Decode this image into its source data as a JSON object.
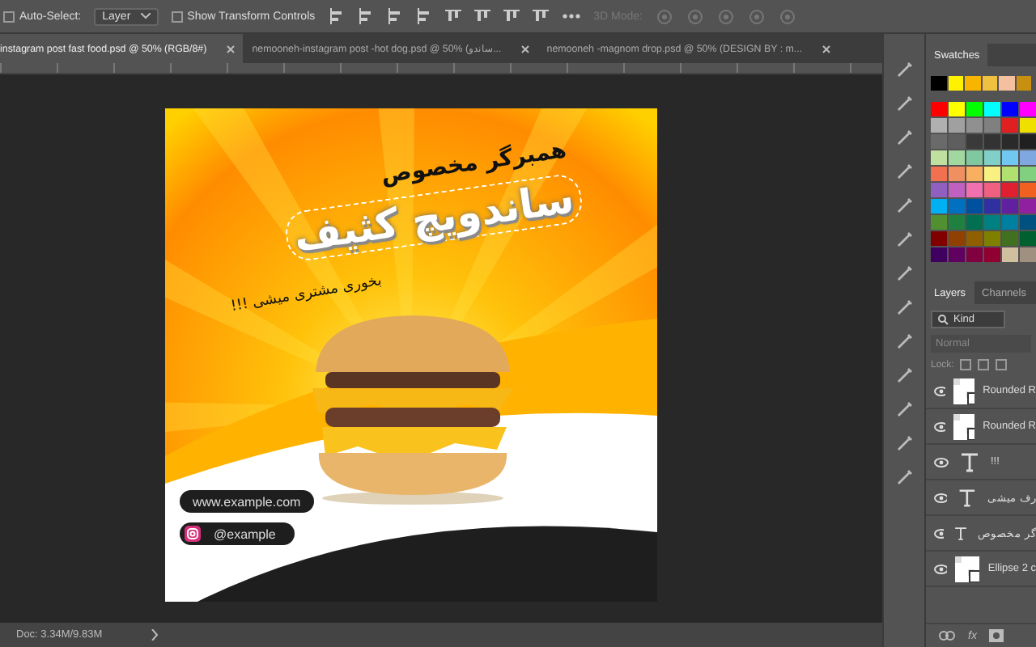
{
  "options_bar": {
    "auto_select": {
      "label": "Auto-Select:",
      "checked": false
    },
    "target": "Layer",
    "transform_controls": {
      "label": "Show Transform Controls",
      "checked": false
    },
    "mode_3d": {
      "label": "3D Mode:",
      "disabled": true
    }
  },
  "tabs": [
    {
      "label": "instagram post fast food.psd @ 50% (RGB/8#)",
      "selected": true
    },
    {
      "label": "nemooneh-instagram post -hot dog.psd @ 50% (ساندو...",
      "selected": false
    },
    {
      "label": "nemooneh -magnom drop.psd @ 50% (DESIGN BY : m...",
      "selected": false
    }
  ],
  "artwork": {
    "subtitle": "همبرگر مخصوص",
    "headline": "ساندویچ کثیف",
    "tagline": "بخوری مشتری میشی !!!",
    "website": "www.example.com",
    "handle": "@example"
  },
  "status_bar": {
    "doc": "Doc: 3.34M/9.83M"
  },
  "swatches": {
    "title": "Swatches",
    "top": [
      {
        "color": "#000000"
      },
      {
        "color": "#fff200"
      },
      {
        "color": "#f7b500"
      },
      {
        "color": "#f0c040"
      },
      {
        "color": "#f5c0a0"
      },
      {
        "color": "#c89010"
      }
    ],
    "grid": [
      [
        {
          "color": "#ff0000"
        },
        {
          "color": "#ffff00"
        },
        {
          "color": "#00ff00"
        },
        {
          "color": "#00ffff"
        },
        {
          "color": "#0000ff"
        },
        {
          "color": "#ff00ff"
        }
      ],
      [
        {
          "color": "#b0b0b0"
        },
        {
          "color": "#a0a0a0"
        },
        {
          "color": "#909090"
        },
        {
          "color": "#808080"
        },
        {
          "color": "#e02020"
        },
        {
          "color": "#f0e000"
        }
      ],
      [
        {
          "color": "#6a6a6a"
        },
        {
          "color": "#5e5e5e"
        },
        {
          "color": "#3a3a3a"
        },
        {
          "color": "#333333"
        },
        {
          "color": "#2a2a2a"
        },
        {
          "color": "#202020"
        }
      ],
      [
        {
          "color": "#c0e0a0"
        },
        {
          "color": "#a0d8a0"
        },
        {
          "color": "#80c8a0"
        },
        {
          "color": "#80d0c8"
        },
        {
          "color": "#70c8f0"
        },
        {
          "color": "#80a8e0"
        }
      ],
      [
        {
          "color": "#f07050"
        },
        {
          "color": "#f09060"
        },
        {
          "color": "#f8b060"
        },
        {
          "color": "#f8f080"
        },
        {
          "color": "#b0e070"
        },
        {
          "color": "#80d080"
        }
      ],
      [
        {
          "color": "#9060c0"
        },
        {
          "color": "#c060c0"
        },
        {
          "color": "#f070b0"
        },
        {
          "color": "#f06080"
        },
        {
          "color": "#e02030"
        },
        {
          "color": "#f06020"
        }
      ],
      [
        {
          "color": "#00b0f0"
        },
        {
          "color": "#0070c0"
        },
        {
          "color": "#0050a0"
        },
        {
          "color": "#3030a0"
        },
        {
          "color": "#6020a0"
        },
        {
          "color": "#9020a0"
        }
      ],
      [
        {
          "color": "#509030"
        },
        {
          "color": "#208040"
        },
        {
          "color": "#007050"
        },
        {
          "color": "#008080"
        },
        {
          "color": "#0080a0"
        },
        {
          "color": "#005080"
        }
      ],
      [
        {
          "color": "#800000"
        },
        {
          "color": "#904000"
        },
        {
          "color": "#906000"
        },
        {
          "color": "#808000"
        },
        {
          "color": "#407020"
        },
        {
          "color": "#006030"
        }
      ],
      [
        {
          "color": "#400060"
        },
        {
          "color": "#600060"
        },
        {
          "color": "#800040"
        },
        {
          "color": "#900030"
        },
        {
          "color": "#d0c0a0"
        },
        {
          "color": "#a09080"
        }
      ]
    ]
  },
  "layers_panel": {
    "tabs": [
      {
        "label": "Layers",
        "selected": true
      },
      {
        "label": "Channels",
        "selected": false
      }
    ],
    "filter": "Kind",
    "blend_mode": "Normal",
    "lock_label": "Lock:",
    "fx": "fx",
    "layers": [
      {
        "kind": "shape",
        "name": "Rounded R",
        "visible": true
      },
      {
        "kind": "shape",
        "name": "Rounded R",
        "visible": true
      },
      {
        "kind": "text",
        "name": "!!!",
        "visible": true
      },
      {
        "kind": "text",
        "name": "رف میشی",
        "visible": true
      },
      {
        "kind": "text",
        "name": "گر مخصوص",
        "visible": true
      },
      {
        "kind": "shape",
        "name": "Ellipse 2 c",
        "visible": true
      }
    ]
  }
}
